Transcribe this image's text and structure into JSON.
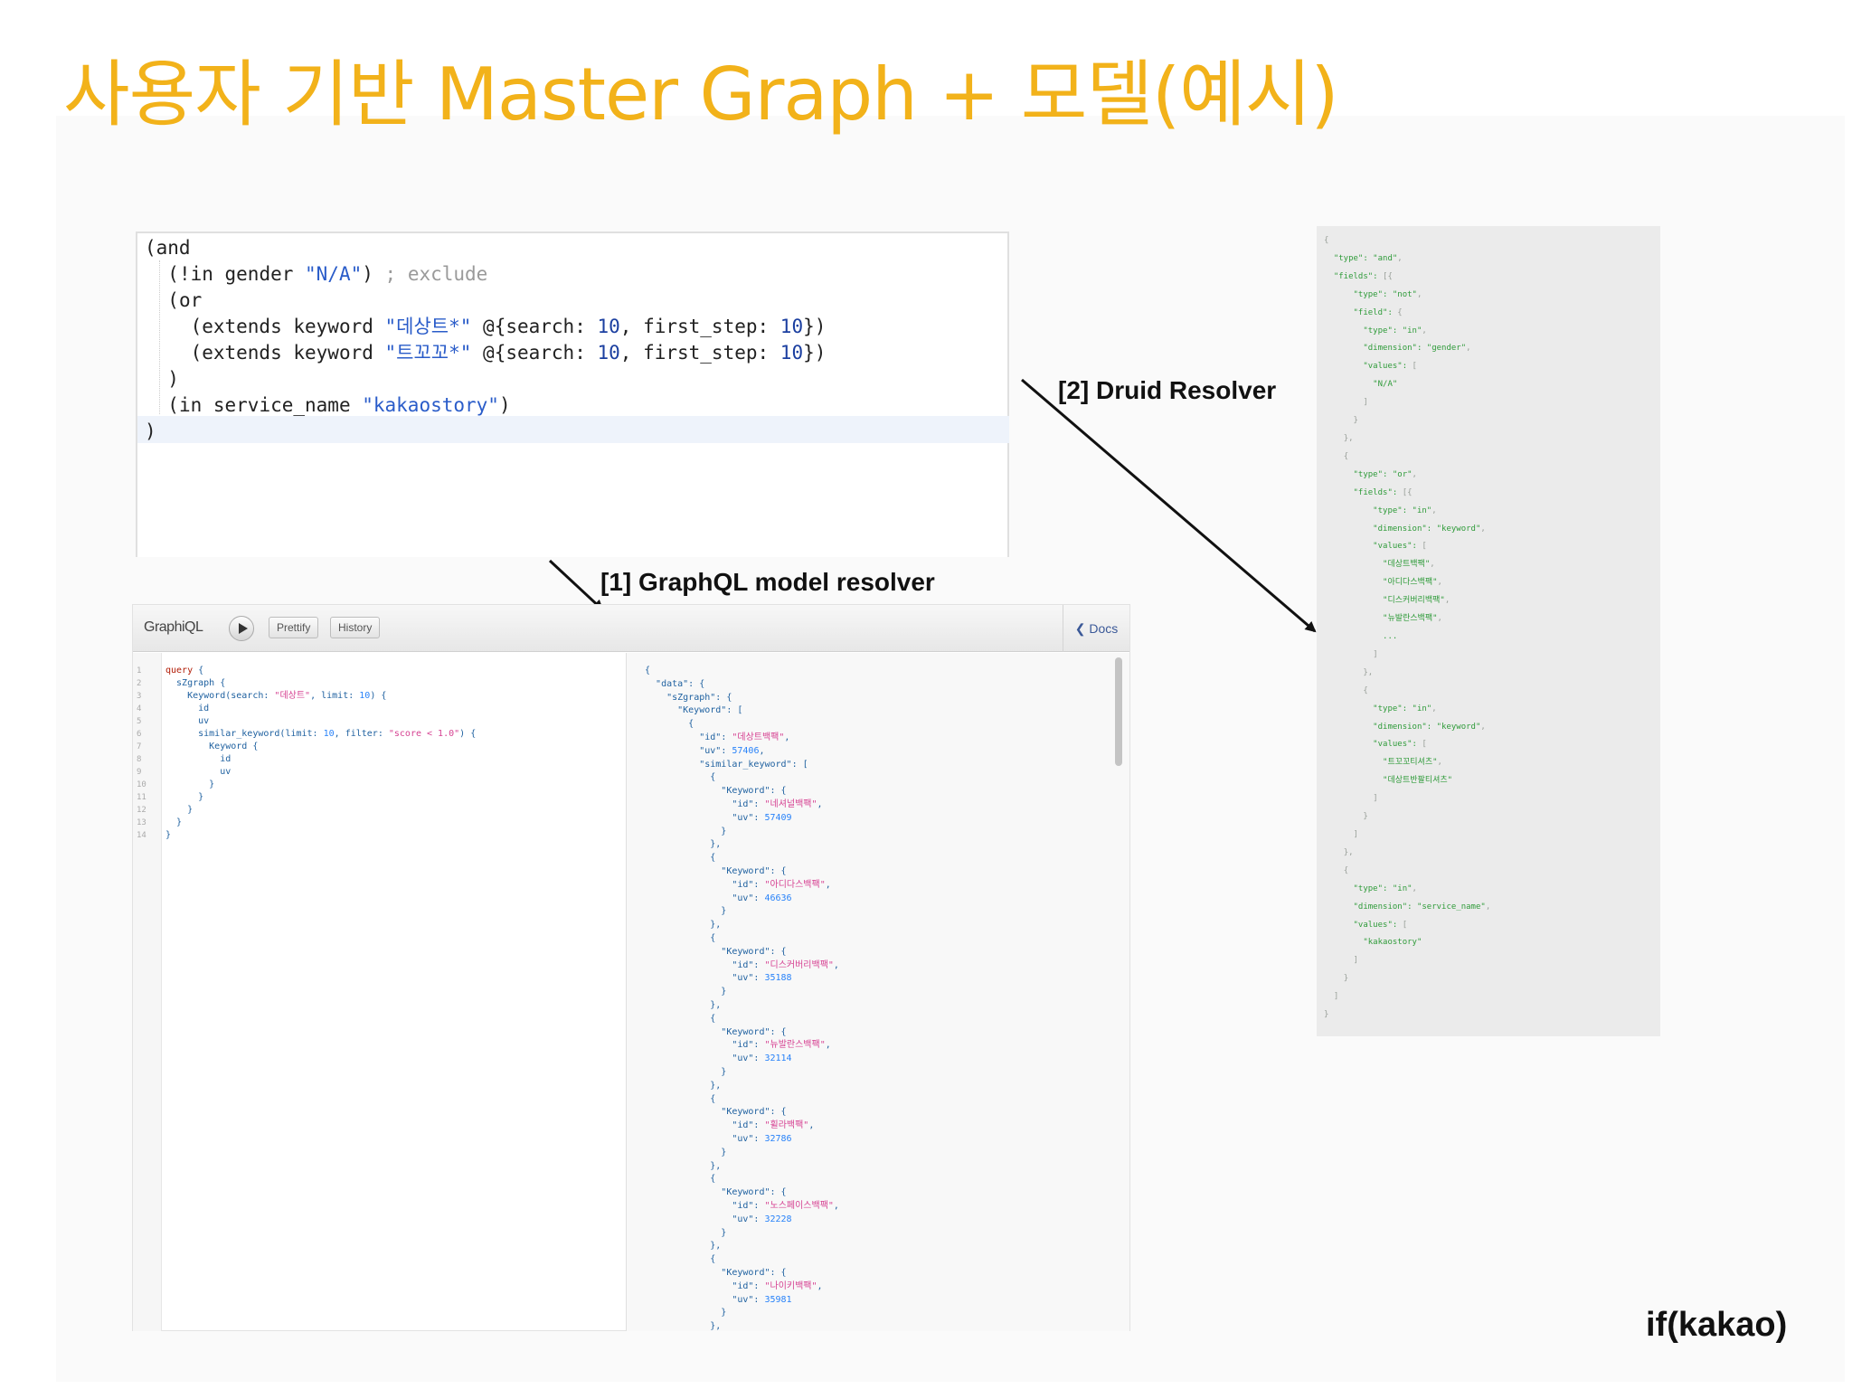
{
  "slide": {
    "title": "사용자 기반 Master Graph + 모델(예시)",
    "brand": "if(kakao)"
  },
  "edn_query": {
    "lines": [
      {
        "indent": "",
        "text": "(and"
      },
      {
        "indent": "  ",
        "text": "(!in gender \"N/A\") ; exclude"
      },
      {
        "indent": "  ",
        "text": "(or"
      },
      {
        "indent": "    ",
        "text": "(extends keyword \"데상트*\" @{search: 10, first_step: 10})"
      },
      {
        "indent": "    ",
        "text": "(extends keyword \"트꼬꼬*\" @{search: 10, first_step: 10})"
      },
      {
        "indent": "  ",
        "text": ")"
      },
      {
        "indent": "  ",
        "text": "(in service_name \"kakaostory\")"
      },
      {
        "indent": "",
        "text": ")"
      }
    ]
  },
  "labels": {
    "graphql_resolver": "[1] GraphQL model resolver",
    "druid_resolver": "[2] Druid Resolver"
  },
  "graphiql": {
    "logo": "GraphiQL",
    "prettify_label": "Prettify",
    "history_label": "History",
    "docs_label": "Docs",
    "docs_chevron": "❮",
    "line_numbers": [
      "1",
      "2",
      "3",
      "4",
      "5",
      "6",
      "7",
      "8",
      "9",
      "10",
      "11",
      "12",
      "13",
      "14"
    ],
    "query_lines": [
      "query {",
      "  sZgraph {",
      "    Keyword(search: \"데상트\", limit: 10) {",
      "      id",
      "      uv",
      "      similar_keyword(limit: 10, filter: \"score < 1.0\") {",
      "        Keyword {",
      "          id",
      "          uv",
      "        }",
      "      }",
      "    }",
      "  }",
      "}"
    ],
    "result_lines": [
      "{",
      "  \"data\": {",
      "    \"sZgraph\": {",
      "      \"Keyword\": [",
      "        {",
      "          \"id\": \"데상트백팩\",",
      "          \"uv\": 57406,",
      "          \"similar_keyword\": [",
      "            {",
      "              \"Keyword\": {",
      "                \"id\": \"네셔널백팩\",",
      "                \"uv\": 57409",
      "              }",
      "            },",
      "            {",
      "              \"Keyword\": {",
      "                \"id\": \"아디다스백팩\",",
      "                \"uv\": 46636",
      "              }",
      "            },",
      "            {",
      "              \"Keyword\": {",
      "                \"id\": \"디스커버리백팩\",",
      "                \"uv\": 35188",
      "              }",
      "            },",
      "            {",
      "              \"Keyword\": {",
      "                \"id\": \"뉴발란스백팩\",",
      "                \"uv\": 32114",
      "              }",
      "            },",
      "            {",
      "              \"Keyword\": {",
      "                \"id\": \"휠라백팩\",",
      "                \"uv\": 32786",
      "              }",
      "            },",
      "            {",
      "              \"Keyword\": {",
      "                \"id\": \"노스페이스백팩\",",
      "                \"uv\": 32228",
      "              }",
      "            },",
      "            {",
      "              \"Keyword\": {",
      "                \"id\": \"나이키백팩\",",
      "                \"uv\": 35981",
      "              }",
      "            },"
    ]
  },
  "druid_json": {
    "lines": [
      "{",
      "  \"type\": \"and\",",
      "  \"fields\": [{",
      "      \"type\": \"not\",",
      "      \"field\": {",
      "        \"type\": \"in\",",
      "        \"dimension\": \"gender\",",
      "        \"values\": [",
      "          \"N/A\"",
      "        ]",
      "      }",
      "    },",
      "    {",
      "      \"type\": \"or\",",
      "      \"fields\": [{",
      "          \"type\": \"in\",",
      "          \"dimension\": \"keyword\",",
      "          \"values\": [",
      "            \"데상트백팩\",",
      "            \"아디다스백팩\",",
      "            \"디스커버리백팩\",",
      "            \"뉴발란스백팩\",",
      "            ...",
      "          ]",
      "        },",
      "        {",
      "          \"type\": \"in\",",
      "          \"dimension\": \"keyword\",",
      "          \"values\": [",
      "            \"트꼬꼬티셔츠\",",
      "            \"데상트반팔티셔츠\"",
      "          ]",
      "        }",
      "      ]",
      "    },",
      "    {",
      "      \"type\": \"in\",",
      "      \"dimension\": \"service_name\",",
      "      \"values\": [",
      "        \"kakaostory\"",
      "      ]",
      "    }",
      "  ]",
      "}"
    ]
  }
}
